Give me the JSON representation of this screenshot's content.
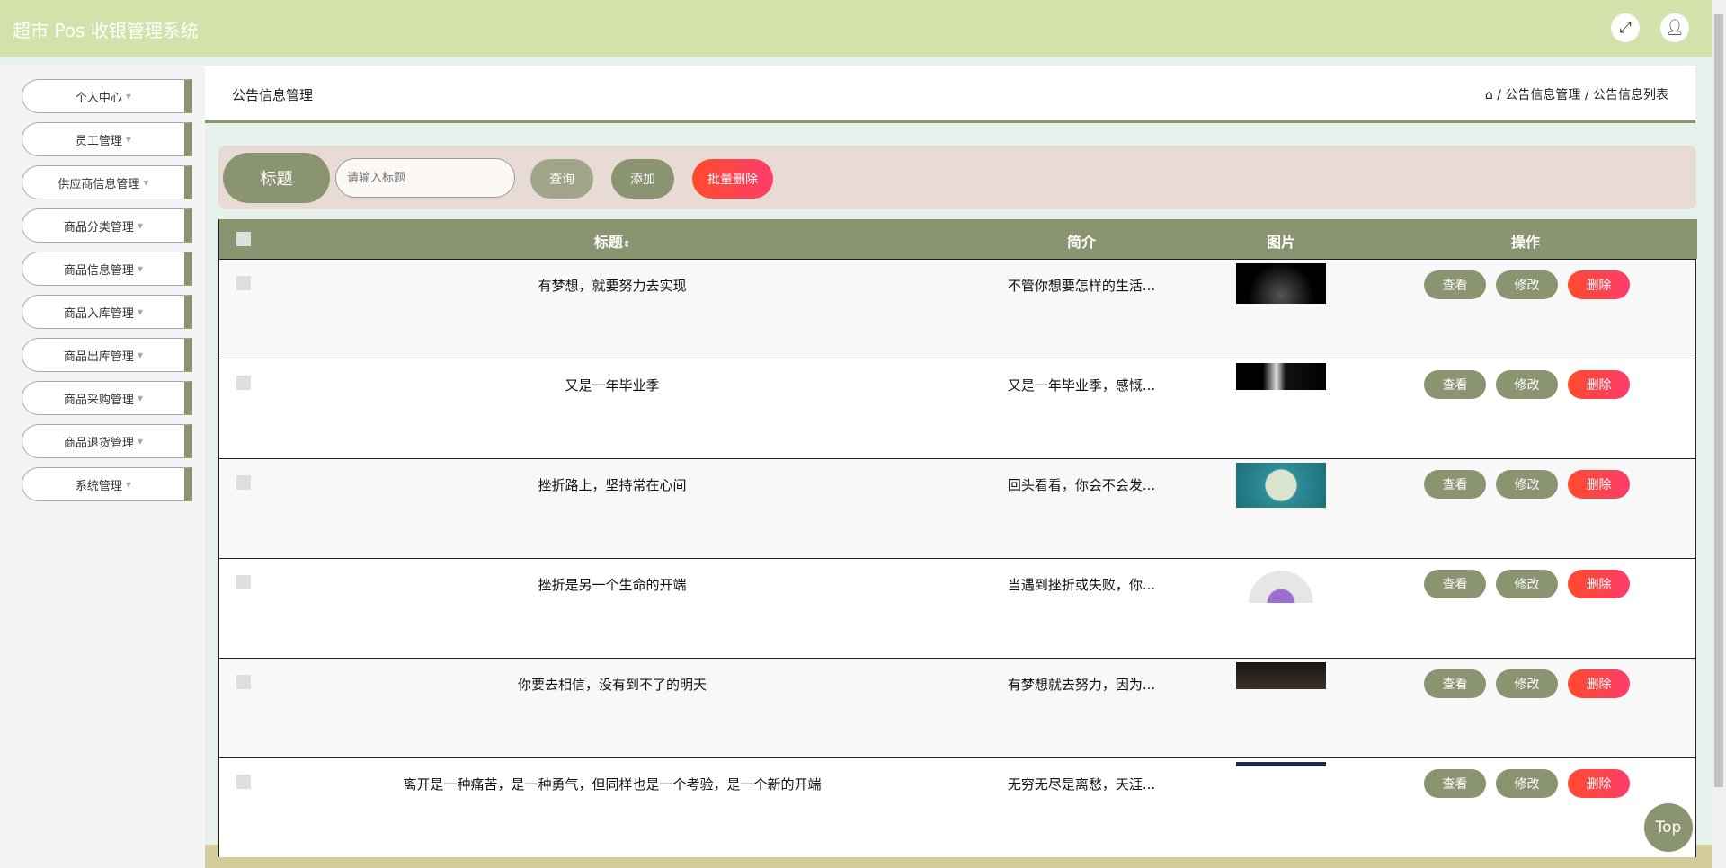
{
  "header": {
    "title": "超市 Pos 收银管理系统",
    "fullscreen_icon": "expand-icon",
    "user_icon": "user-icon"
  },
  "sidebar": {
    "items": [
      {
        "label": "个人中心"
      },
      {
        "label": "员工管理"
      },
      {
        "label": "供应商信息管理"
      },
      {
        "label": "商品分类管理"
      },
      {
        "label": "商品信息管理"
      },
      {
        "label": "商品入库管理"
      },
      {
        "label": "商品出库管理"
      },
      {
        "label": "商品采购管理"
      },
      {
        "label": "商品退货管理"
      },
      {
        "label": "系统管理"
      }
    ]
  },
  "page": {
    "title": "公告信息管理",
    "breadcrumb": [
      "公告信息管理",
      "公告信息列表"
    ]
  },
  "search": {
    "label": "标题",
    "placeholder": "请输入标题",
    "query": "查询",
    "add": "添加",
    "batch_delete": "批量删除"
  },
  "table": {
    "headers": {
      "title": "标题",
      "intro": "简介",
      "image": "图片",
      "actions": "操作"
    },
    "rows": [
      {
        "title": "有梦想，就要努力去实现",
        "intro": "不管你想要怎样的生活..."
      },
      {
        "title": "又是一年毕业季",
        "intro": "又是一年毕业季，感慨..."
      },
      {
        "title": "挫折路上，坚持常在心间",
        "intro": "回头看看，你会不会发..."
      },
      {
        "title": "挫折是另一个生命的开端",
        "intro": "当遇到挫折或失败，你..."
      },
      {
        "title": "你要去相信，没有到不了的明天",
        "intro": "有梦想就去努力，因为..."
      },
      {
        "title": "离开是一种痛苦，是一种勇气，但同样也是一个考验，是一个新的开端",
        "intro": "无穷无尽是离愁，天涯..."
      }
    ],
    "view": "查看",
    "edit": "修改",
    "delete": "删除"
  },
  "top_button": "Top",
  "colors": {
    "accent": "#8b9470",
    "header": "#d3e2aa",
    "danger": "#ff4a2d"
  }
}
